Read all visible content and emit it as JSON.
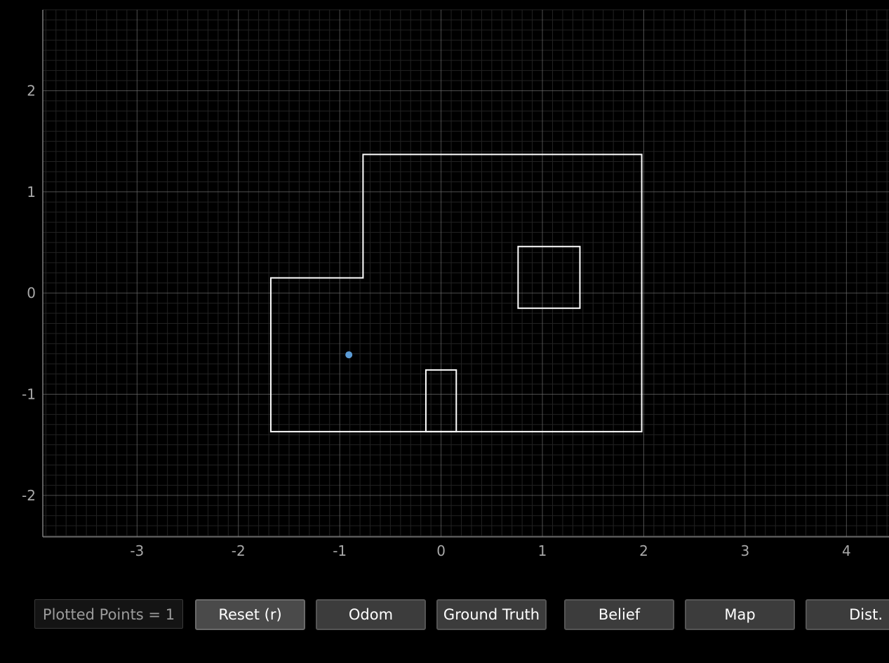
{
  "plot": {
    "colors": {
      "background": "#000000",
      "grid_major": "#6e6e6e",
      "grid_minor": "#222222",
      "axis": "#7a7a7a",
      "map_lines": "#ffffff",
      "belief_point": "#5b9bd5"
    },
    "axes": {
      "x_ticks": [
        {
          "value": -3,
          "label": "-3"
        },
        {
          "value": -2,
          "label": "-2"
        },
        {
          "value": -1,
          "label": "-1"
        },
        {
          "value": 0,
          "label": "0"
        },
        {
          "value": 1,
          "label": "1"
        },
        {
          "value": 2,
          "label": "2"
        },
        {
          "value": 3,
          "label": "3"
        },
        {
          "value": 4,
          "label": "4"
        }
      ],
      "y_ticks": [
        {
          "value": -2,
          "label": "-2"
        },
        {
          "value": -1,
          "label": "-1"
        },
        {
          "value": 0,
          "label": "0"
        },
        {
          "value": 1,
          "label": "1"
        },
        {
          "value": 2,
          "label": "2"
        }
      ],
      "xlim": [
        -3.93,
        4.42
      ],
      "ylim": [
        -2.41,
        2.8
      ],
      "grid": true
    },
    "map_polygons": [
      {
        "name": "outer-wall",
        "points": [
          [
            -1.68,
            0.15
          ],
          [
            -0.77,
            0.15
          ],
          [
            -0.77,
            1.37
          ],
          [
            1.98,
            1.37
          ],
          [
            1.98,
            -1.37
          ],
          [
            -1.68,
            -1.37
          ]
        ]
      },
      {
        "name": "box-obstacle",
        "points": [
          [
            0.76,
            0.46
          ],
          [
            1.37,
            0.46
          ],
          [
            1.37,
            -0.15
          ],
          [
            0.76,
            -0.15
          ]
        ]
      },
      {
        "name": "pillar-obstacle",
        "points": [
          [
            -0.15,
            -1.37
          ],
          [
            -0.15,
            -0.76
          ],
          [
            0.15,
            -0.76
          ],
          [
            0.15,
            -1.37
          ]
        ]
      }
    ],
    "points": [
      {
        "x": -0.91,
        "y": -0.61
      }
    ]
  },
  "toolbar": {
    "counter_label": "Plotted Points = 1",
    "buttons": [
      {
        "id": "reset",
        "label": "Reset (r)",
        "active": true
      },
      {
        "id": "odom",
        "label": "Odom",
        "active": false
      },
      {
        "id": "ground-truth",
        "label": "Ground Truth",
        "active": false
      },
      {
        "id": "belief",
        "label": "Belief",
        "active": false
      },
      {
        "id": "map",
        "label": "Map",
        "active": false
      },
      {
        "id": "dist",
        "label": "Dist.",
        "active": false
      }
    ]
  }
}
